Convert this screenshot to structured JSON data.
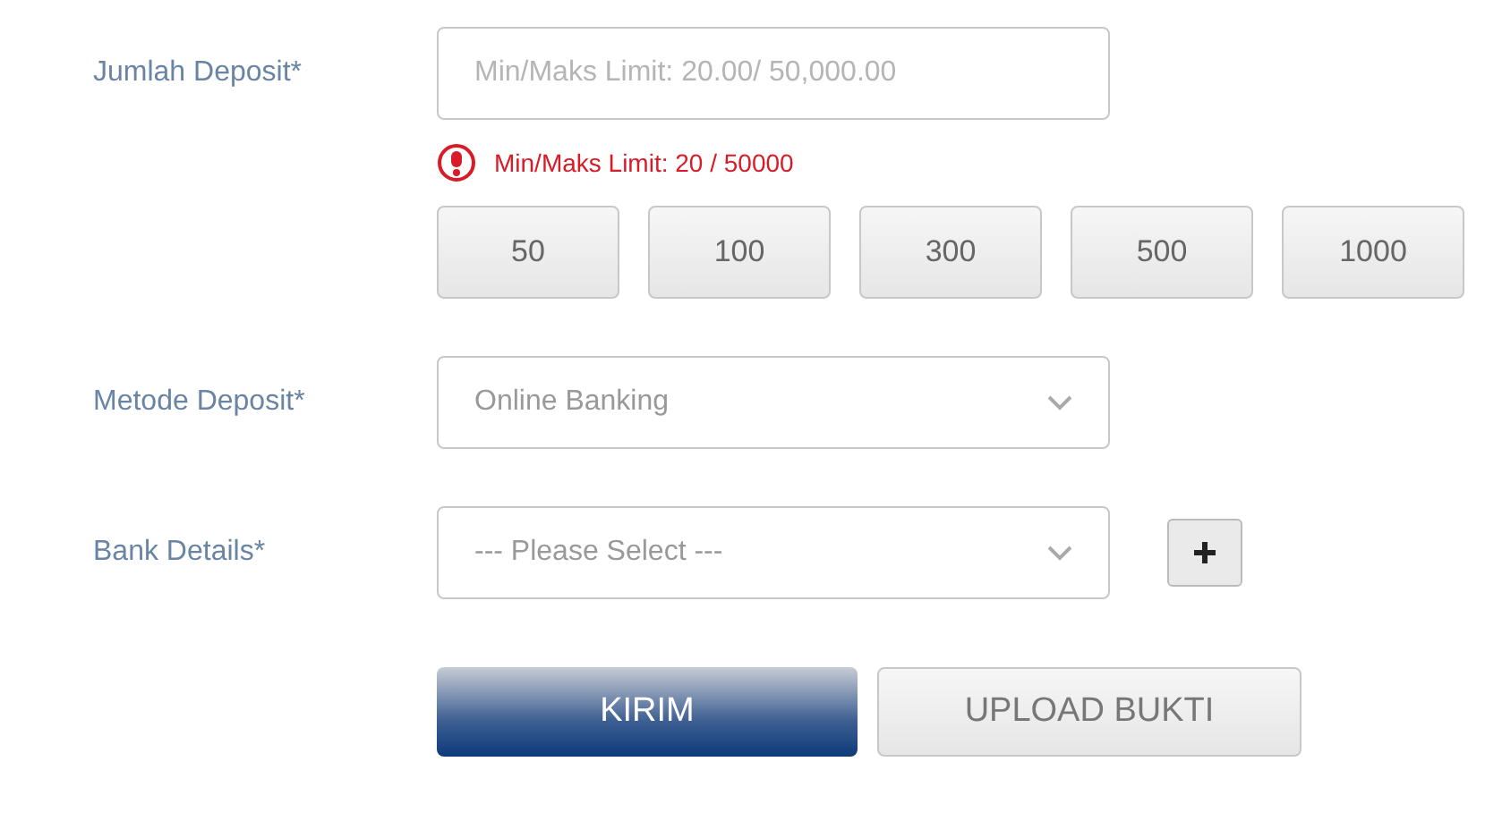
{
  "deposit_amount": {
    "label": "Jumlah Deposit*",
    "placeholder": "Min/Maks Limit: 20.00/ 50,000.00",
    "error": "Min/Maks Limit: 20 / 50000"
  },
  "quick_amounts": [
    "50",
    "100",
    "300",
    "500",
    "1000"
  ],
  "deposit_method": {
    "label": "Metode Deposit*",
    "value": "Online Banking"
  },
  "bank_details": {
    "label": "Bank Details*",
    "value": "--- Please Select ---"
  },
  "buttons": [
    {
      "label": "KIRIM",
      "kind": "primary"
    },
    {
      "label": "UPLOAD BUKTI",
      "kind": "secondary"
    }
  ]
}
